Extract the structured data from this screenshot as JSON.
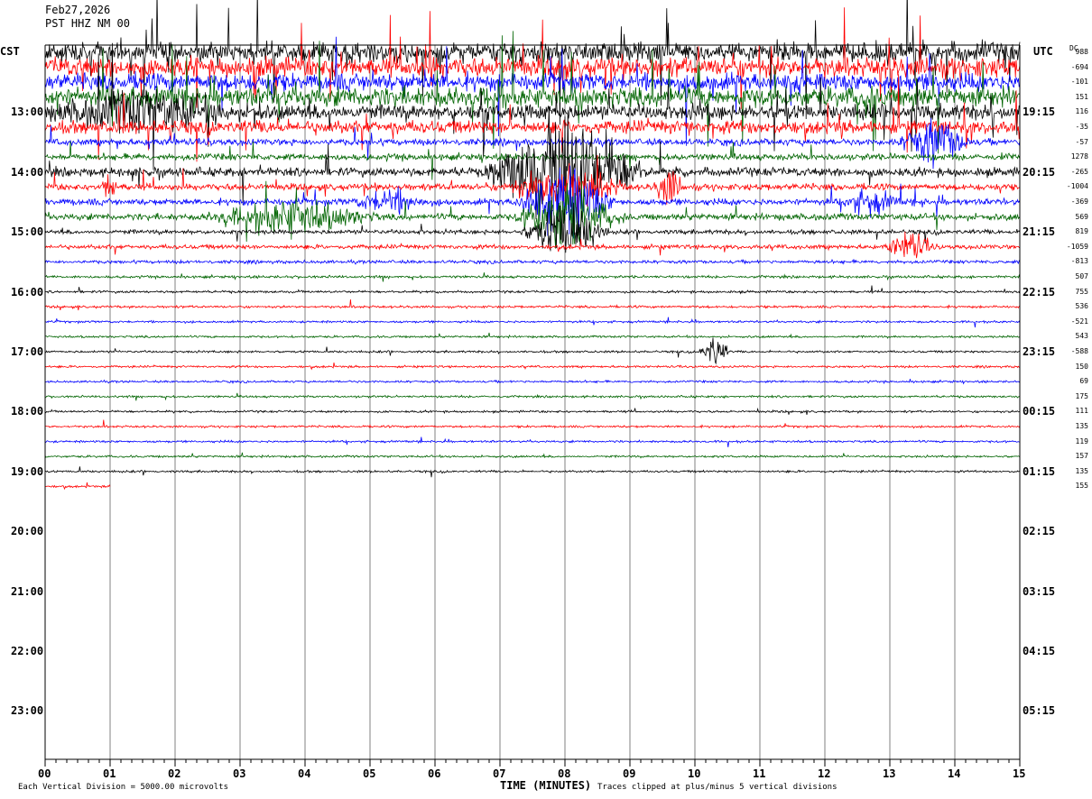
{
  "header": {
    "date": "Feb27,2026",
    "station": "PST HHZ NM 00"
  },
  "left_timezone": "CST",
  "right_timezone": "UTC",
  "dc_header": "DC",
  "chart_data": {
    "type": "line",
    "title": "",
    "xlabel": "TIME (MINUTES)",
    "x_ticks": [
      "00",
      "01",
      "02",
      "03",
      "04",
      "05",
      "06",
      "07",
      "08",
      "09",
      "10",
      "11",
      "12",
      "13",
      "14",
      "15"
    ],
    "xlim": [
      0,
      15
    ],
    "left_hour_labels": [
      "13:00",
      "14:00",
      "15:00",
      "16:00",
      "17:00",
      "18:00",
      "19:00",
      "20:00",
      "21:00",
      "22:00",
      "23:00"
    ],
    "right_hour_labels": [
      "19:15",
      "20:15",
      "21:15",
      "22:15",
      "23:15",
      "00:15",
      "01:15",
      "02:15",
      "03:15",
      "04:15",
      "05:15"
    ],
    "trace_colors": [
      "#000000",
      "#ff0000",
      "#0000ff",
      "#006400"
    ],
    "dc_offsets": [
      "988",
      "-694",
      "-101",
      "151",
      "116",
      "-35",
      "-57",
      "1278",
      "-265",
      "-1004",
      "-369",
      "569",
      "819",
      "-1059",
      "-813",
      "507",
      "755",
      "536",
      "-521",
      "543",
      "-588",
      "150",
      "69",
      "175",
      "111",
      "135",
      "119",
      "157",
      "135",
      "155"
    ],
    "trace_activity": [
      9,
      9,
      8,
      9,
      7,
      6,
      3,
      3,
      4,
      3,
      3,
      3,
      2,
      2,
      1.5,
      1.2,
      1.1,
      1.1,
      1,
      1,
      1,
      1,
      1,
      1,
      1,
      1,
      1,
      1,
      1,
      1
    ],
    "partial_last_trace_minutes": 1.0,
    "events": [
      {
        "trace": 8,
        "minute": 8.0,
        "amplitude": 4.0,
        "width": 1.3
      },
      {
        "trace": 9,
        "minute": 8.0,
        "amplitude": 1.5,
        "width": 1.0
      },
      {
        "trace": 10,
        "minute": 8.0,
        "amplitude": 2.5,
        "width": 0.8
      },
      {
        "trace": 11,
        "minute": 8.0,
        "amplitude": 2.5,
        "width": 0.8
      },
      {
        "trace": 12,
        "minute": 8.0,
        "amplitude": 2.0,
        "width": 0.7
      },
      {
        "trace": 13,
        "minute": 13.3,
        "amplitude": 1.0,
        "width": 0.4
      },
      {
        "trace": 9,
        "minute": 1.0,
        "amplitude": 1.0,
        "width": 0.15
      },
      {
        "trace": 9,
        "minute": 9.6,
        "amplitude": 1.3,
        "width": 0.25
      },
      {
        "trace": 11,
        "minute": 3.8,
        "amplitude": 1.1,
        "width": 1.4
      },
      {
        "trace": 10,
        "minute": 5.3,
        "amplitude": 0.8,
        "width": 0.6
      },
      {
        "trace": 10,
        "minute": 12.7,
        "amplitude": 0.8,
        "width": 0.5
      },
      {
        "trace": 6,
        "minute": 13.7,
        "amplitude": 1.5,
        "width": 0.6
      },
      {
        "trace": 20,
        "minute": 10.3,
        "amplitude": 1.2,
        "width": 0.25
      },
      {
        "trace": 4,
        "minute": 1.5,
        "amplitude": 1.2,
        "width": 1.5
      }
    ]
  },
  "footer": {
    "scale": "Each Vertical Division = 5000.00 microvolts",
    "clip": "Traces clipped at plus/minus 5 vertical divisions"
  }
}
